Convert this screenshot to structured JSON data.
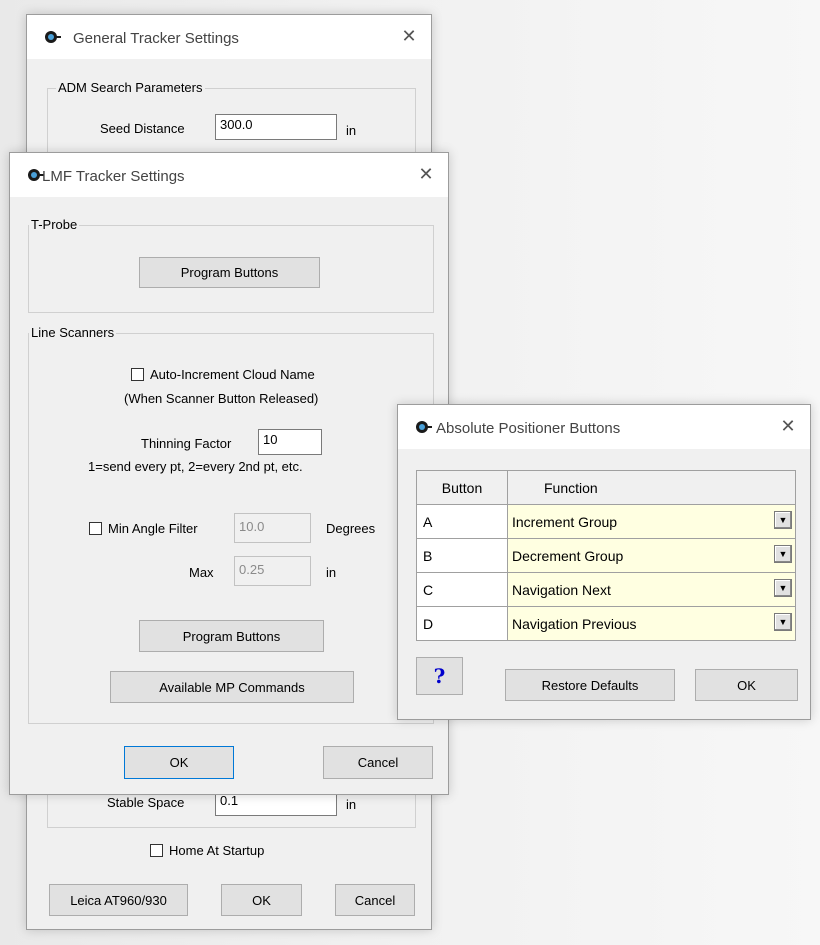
{
  "general_window": {
    "title": "General Tracker Settings",
    "adm_group_label": "ADM Search Parameters",
    "seed_distance_label": "Seed Distance",
    "seed_distance_value": "300.0",
    "seed_distance_unit": "in",
    "stable_space_label": "Stable Space",
    "stable_space_value": "0.1",
    "stable_space_unit": "in",
    "home_at_startup_label": "Home At Startup",
    "leica_button": "Leica AT960/930",
    "ok_button": "OK",
    "cancel_button": "Cancel"
  },
  "lmf_window": {
    "title": "LMF Tracker Settings",
    "tprobe_group_label": "T-Probe",
    "tprobe_program_buttons": "Program Buttons",
    "line_scanners_group_label": "Line Scanners",
    "auto_increment_label": "Auto-Increment Cloud Name",
    "auto_increment_note": "(When Scanner Button Released)",
    "thinning_factor_label": "Thinning Factor",
    "thinning_factor_value": "10",
    "thinning_note": "1=send every pt, 2=every 2nd pt, etc.",
    "min_angle_filter_label": "Min Angle Filter",
    "min_angle_value": "10.0",
    "min_angle_unit": "Degrees",
    "max_label": "Max",
    "max_value": "0.25",
    "max_unit": "in",
    "ls_program_buttons": "Program Buttons",
    "available_mp_commands": "Available MP Commands",
    "ok_button": "OK",
    "cancel_button": "Cancel"
  },
  "abs_window": {
    "title": "Absolute Positioner Buttons",
    "col_button": "Button",
    "col_function": "Function",
    "rows": [
      {
        "button": "A",
        "function": "Increment Group"
      },
      {
        "button": "B",
        "function": "Decrement Group"
      },
      {
        "button": "C",
        "function": "Navigation Next"
      },
      {
        "button": "D",
        "function": "Navigation Previous"
      }
    ],
    "help_button": "?",
    "restore_defaults_button": "Restore Defaults",
    "ok_button": "OK"
  },
  "icons": {
    "app_icon": "app-logo-icon",
    "close": "close-icon",
    "dropdown": "chevron-down-icon"
  },
  "colors": {
    "function_cell_bg": "#ffffe1",
    "help_color": "#0000cc",
    "default_button_border": "#0078d7"
  }
}
